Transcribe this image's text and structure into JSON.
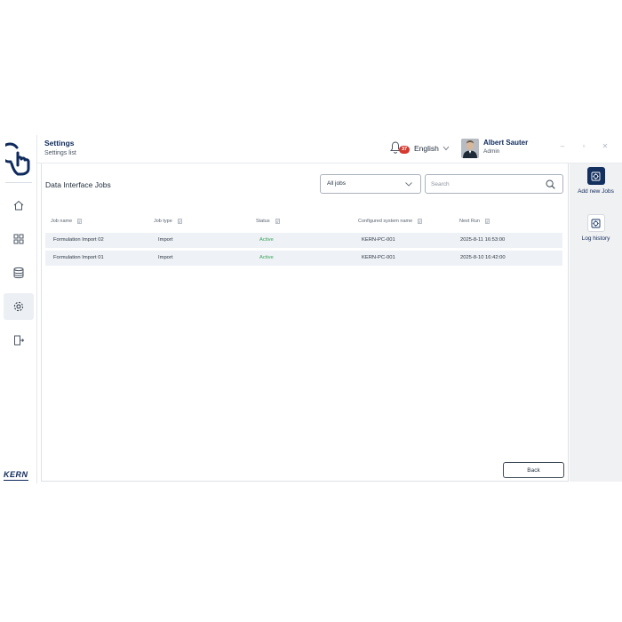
{
  "header": {
    "title": "Settings",
    "subtitle": "Settings list",
    "notification_count": "37",
    "language": "English",
    "user_name": "Albert Sauter",
    "user_role": "Admin"
  },
  "sidebar": {
    "items": [
      {
        "icon": "home-icon"
      },
      {
        "icon": "apps-grid-icon"
      },
      {
        "icon": "database-icon"
      },
      {
        "icon": "gear-icon",
        "active": true
      },
      {
        "icon": "logout-icon"
      }
    ],
    "brand": "KERN"
  },
  "main": {
    "section_title": "Data Interface Jobs",
    "filter": {
      "selected": "All jobs"
    },
    "search": {
      "placeholder": "Search"
    },
    "columns": [
      "Job name",
      "Job type",
      "Status",
      "Configured system name",
      "Next Run"
    ],
    "rows": [
      {
        "job_name": "Formulation Import 02",
        "job_type": "Import",
        "status": "Active",
        "system": "KERN-PC-001",
        "next_run": "2025-8-11 16:53:00"
      },
      {
        "job_name": "Formulation Import 01",
        "job_type": "Import",
        "status": "Active",
        "system": "KERN-PC-001",
        "next_run": "2025-8-10 16:42:00"
      }
    ],
    "back_label": "Back"
  },
  "actions": [
    {
      "label": "Add new Jobs",
      "icon": "add-job-icon"
    },
    {
      "label": "Log history",
      "icon": "log-history-icon"
    }
  ],
  "colors": {
    "brand_navy": "#0f2a5c",
    "active_green": "#3aa35c",
    "badge_red": "#d63a2f",
    "row_bg": "#eef1f5"
  }
}
